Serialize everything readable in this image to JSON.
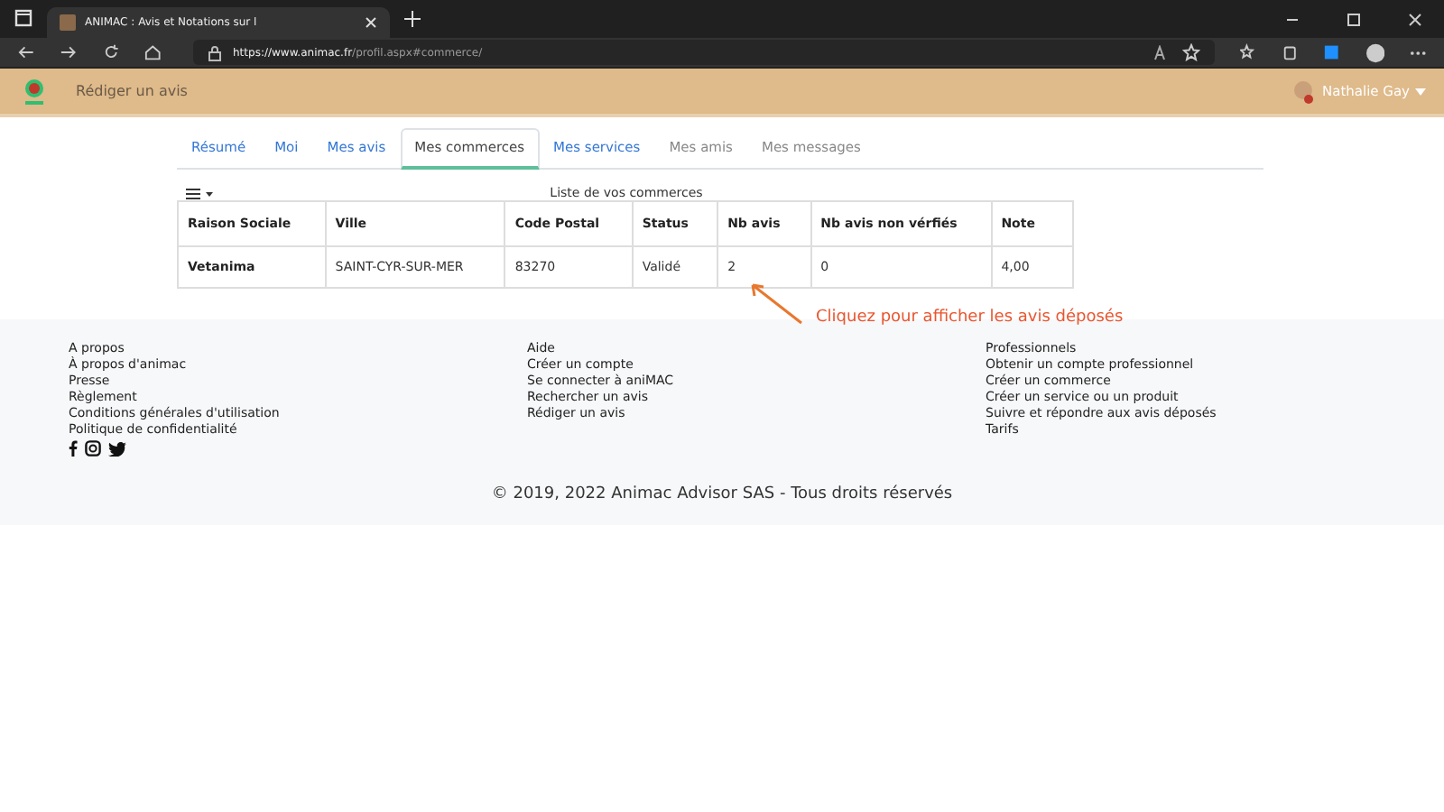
{
  "browser": {
    "tab_title": "ANIMAC : Avis et Notations sur l",
    "url_host": "https://www.animac.fr",
    "url_path": "/profil.aspx#commerce/"
  },
  "navbar": {
    "link": "Rédiger un avis",
    "user": "Nathalie Gay"
  },
  "tabs": [
    {
      "label": "Résumé",
      "selected": false,
      "disabled": false
    },
    {
      "label": "Moi",
      "selected": false,
      "disabled": false
    },
    {
      "label": "Mes avis",
      "selected": false,
      "disabled": false
    },
    {
      "label": "Mes commerces",
      "selected": true,
      "disabled": false
    },
    {
      "label": "Mes services",
      "selected": false,
      "disabled": false
    },
    {
      "label": "Mes amis",
      "selected": false,
      "disabled": true
    },
    {
      "label": "Mes messages",
      "selected": false,
      "disabled": true
    }
  ],
  "table": {
    "caption": "Liste de vos commerces",
    "columns": [
      "Raison Sociale",
      "Ville",
      "Code Postal",
      "Status",
      "Nb avis",
      "Nb avis non vérfiés",
      "Note"
    ],
    "rows": [
      [
        "Vetanima",
        "SAINT-CYR-SUR-MER",
        "83270",
        "Validé",
        "2",
        "0",
        "4,00"
      ]
    ]
  },
  "annotation": "Cliquez pour afficher les avis déposés",
  "footer": {
    "columns": [
      [
        "A propos",
        "À propos d'animac",
        "Presse",
        "Règlement",
        "Conditions générales d'utilisation",
        "Politique de confidentialité"
      ],
      [
        "Aide",
        "Créer un compte",
        "Se connecter à aniMAC",
        "Rechercher un avis",
        "Rédiger un avis"
      ],
      [
        "Professionnels",
        "Obtenir un compte professionnel",
        "Créer un commerce",
        "Créer un service ou un produit",
        "Suivre et répondre aux avis déposés",
        "Tarifs"
      ]
    ],
    "copyright": "© 2019, 2022 Animac Advisor SAS - Tous droits réservés"
  }
}
